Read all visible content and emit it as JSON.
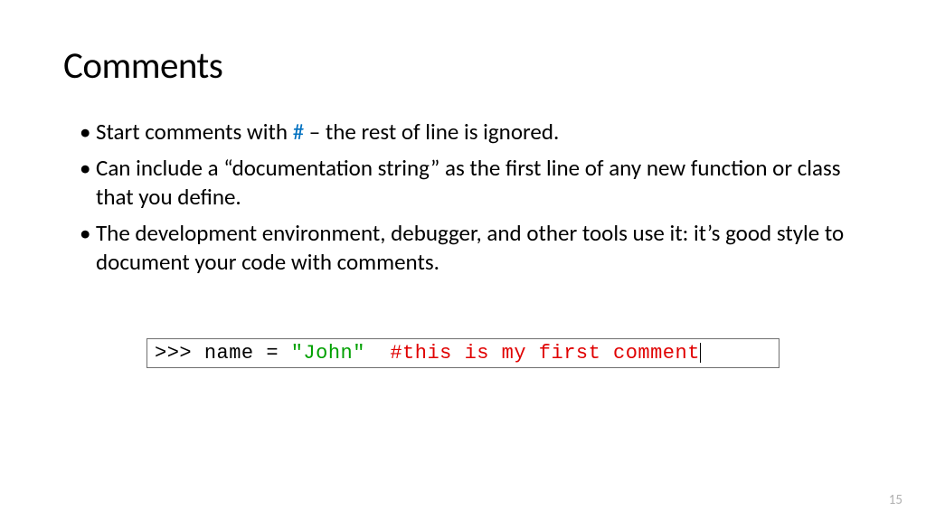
{
  "title": "Comments",
  "bullets": {
    "b1_pre": "Start comments with ",
    "b1_hash": "#",
    "b1_post": " – the rest of line is ignored.",
    "b2": "Can include a “documentation string” as the first line of any new function or class that you define.",
    "b3": "The development environment, debugger, and other tools use it: it’s good style to document your code with comments."
  },
  "code": {
    "prompt": ">>> ",
    "assign": "name = ",
    "string": "\"John\"",
    "gap": "  ",
    "comment": "#this is my first comment"
  },
  "page_number": "15"
}
